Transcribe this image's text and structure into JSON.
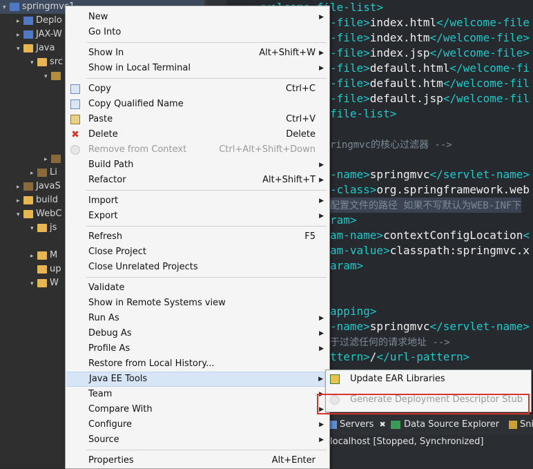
{
  "explorer": {
    "rows": [
      {
        "label": "springmvc1",
        "arrow": "▾",
        "icon": "project-icon"
      },
      {
        "label": "Deplo",
        "arrow": "▸",
        "icon": "deployment-icon"
      },
      {
        "label": "JAX-W",
        "arrow": "▸",
        "icon": "jaxws-icon"
      },
      {
        "label": "Java",
        "arrow": "▾",
        "icon": "java-resources-icon"
      },
      {
        "label": "src",
        "arrow": "▾",
        "icon": "folder-icon"
      },
      {
        "label": "",
        "arrow": "▾",
        "icon": "package-icon"
      },
      {
        "label": "",
        "arrow": "▸",
        "icon": "jar-icon"
      },
      {
        "label": "Li",
        "arrow": "▸",
        "icon": "library-icon"
      },
      {
        "label": "JavaS",
        "arrow": "▸",
        "icon": "jar-icon"
      },
      {
        "label": "build",
        "arrow": "▸",
        "icon": "folder-icon"
      },
      {
        "label": "WebC",
        "arrow": "▾",
        "icon": "folder-icon"
      },
      {
        "label": "js",
        "arrow": "▾",
        "icon": "folder-icon"
      },
      {
        "label": "M",
        "arrow": "▸",
        "icon": "folder-icon"
      },
      {
        "label": "up",
        "arrow": "",
        "icon": "folder-icon"
      },
      {
        "label": "W",
        "arrow": "▾",
        "icon": "folder-icon"
      }
    ]
  },
  "editor": {
    "lines": [
      {
        "tag1": "<welcome-file-list>",
        "text": "",
        "tag2": ""
      },
      {
        "tag1": "-file>",
        "text": "index.html",
        "tag2": "</welcome-file"
      },
      {
        "tag1": "-file>",
        "text": "index.htm",
        "tag2": "</welcome-file>"
      },
      {
        "tag1": "-file>",
        "text": "index.jsp",
        "tag2": "</welcome-file>"
      },
      {
        "tag1": "-file>",
        "text": "default.html",
        "tag2": "</welcome-fi"
      },
      {
        "tag1": "-file>",
        "text": "default.htm",
        "tag2": "</welcome-fil"
      },
      {
        "tag1": "-file>",
        "text": "default.jsp",
        "tag2": "</welcome-fil"
      },
      {
        "tag1": "file-list>",
        "text": "",
        "tag2": ""
      },
      {
        "comment": "ringmvc的核心过滤器 -->"
      },
      {
        "tag1": "-name>",
        "text": "springmvc",
        "tag2": "</servlet-name>"
      },
      {
        "tag1": "-class>",
        "text": "org.springframework.web",
        "tag2": ""
      },
      {
        "comment": "配置文件的路径 如果不写默认为WEB-INF下"
      },
      {
        "tag1": "ram>",
        "text": "",
        "tag2": ""
      },
      {
        "tag1": "am-name>",
        "text": "contextConfigLocation",
        "tag2": "<"
      },
      {
        "tag1": "am-value>",
        "text": "classpath:springmvc.x",
        "tag2": ""
      },
      {
        "tag1": "aram>",
        "text": "",
        "tag2": ""
      },
      {
        "tag1": "apping>",
        "text": "",
        "tag2": ""
      },
      {
        "tag1": "-name>",
        "text": "springmvc",
        "tag2": "</servlet-name>"
      },
      {
        "comment": "于过滤任何的请求地址 -->"
      },
      {
        "tag1": "ttern>",
        "text": "/",
        "tag2": "</url-pattern>"
      }
    ]
  },
  "views": {
    "tabs": [
      {
        "label": "Servers",
        "close": "✖"
      },
      {
        "label": "Data Source Explorer",
        "close": ""
      },
      {
        "label": "Snipp",
        "close": ""
      }
    ],
    "server_entry": "localhost  [Stopped, Synchronized]"
  },
  "menu": {
    "items": [
      {
        "label": "New",
        "accel": "",
        "submenu": true,
        "icon": ""
      },
      {
        "label": "Go Into",
        "accel": "",
        "submenu": false,
        "icon": ""
      },
      {
        "sep": true
      },
      {
        "label": "Show In",
        "accel": "Alt+Shift+W",
        "submenu": true,
        "icon": ""
      },
      {
        "label": "Show in Local Terminal",
        "accel": "",
        "submenu": true,
        "icon": ""
      },
      {
        "sep": true
      },
      {
        "label": "Copy",
        "accel": "Ctrl+C",
        "submenu": false,
        "icon": "copy-icon"
      },
      {
        "label": "Copy Qualified Name",
        "accel": "",
        "submenu": false,
        "icon": "copy-qualified-icon"
      },
      {
        "label": "Paste",
        "accel": "Ctrl+V",
        "submenu": false,
        "icon": "paste-icon"
      },
      {
        "label": "Delete",
        "accel": "Delete",
        "submenu": false,
        "icon": "delete-icon"
      },
      {
        "label": "Remove from Context",
        "accel": "Ctrl+Alt+Shift+Down",
        "submenu": false,
        "icon": "remove-context-icon",
        "disabled": true
      },
      {
        "label": "Build Path",
        "accel": "",
        "submenu": true,
        "icon": ""
      },
      {
        "label": "Refactor",
        "accel": "Alt+Shift+T",
        "submenu": true,
        "icon": ""
      },
      {
        "sep": true
      },
      {
        "label": "Import",
        "accel": "",
        "submenu": true,
        "icon": ""
      },
      {
        "label": "Export",
        "accel": "",
        "submenu": true,
        "icon": ""
      },
      {
        "sep": true
      },
      {
        "label": "Refresh",
        "accel": "F5",
        "submenu": false,
        "icon": ""
      },
      {
        "label": "Close Project",
        "accel": "",
        "submenu": false,
        "icon": ""
      },
      {
        "label": "Close Unrelated Projects",
        "accel": "",
        "submenu": false,
        "icon": ""
      },
      {
        "sep": true
      },
      {
        "label": "Validate",
        "accel": "",
        "submenu": false,
        "icon": ""
      },
      {
        "label": "Show in Remote Systems view",
        "accel": "",
        "submenu": false,
        "icon": ""
      },
      {
        "label": "Run As",
        "accel": "",
        "submenu": true,
        "icon": ""
      },
      {
        "label": "Debug As",
        "accel": "",
        "submenu": true,
        "icon": ""
      },
      {
        "label": "Profile As",
        "accel": "",
        "submenu": true,
        "icon": ""
      },
      {
        "label": "Restore from Local History...",
        "accel": "",
        "submenu": false,
        "icon": ""
      },
      {
        "label": "Java EE Tools",
        "accel": "",
        "submenu": true,
        "icon": "",
        "active": true
      },
      {
        "label": "Team",
        "accel": "",
        "submenu": true,
        "icon": ""
      },
      {
        "label": "Compare With",
        "accel": "",
        "submenu": true,
        "icon": ""
      },
      {
        "label": "Configure",
        "accel": "",
        "submenu": true,
        "icon": ""
      },
      {
        "label": "Source",
        "accel": "",
        "submenu": true,
        "icon": ""
      },
      {
        "sep": true
      },
      {
        "label": "Properties",
        "accel": "Alt+Enter",
        "submenu": false,
        "icon": ""
      }
    ]
  },
  "submenu": {
    "items": [
      {
        "label": "Update EAR Libraries",
        "icon": "ear-libraries-icon",
        "disabled": false
      },
      {
        "label": "Generate Deployment Descriptor Stub",
        "icon": "descriptor-stub-icon",
        "disabled": true
      }
    ]
  },
  "colors": {
    "highlight_box": "#d9342b",
    "tag": "#1ec9c9",
    "menu_active": "#d6e6f6"
  }
}
